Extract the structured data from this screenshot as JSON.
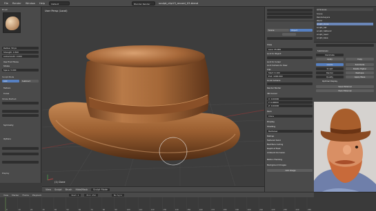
{
  "topbar": {
    "menu": [
      "File",
      "Render",
      "Window",
      "Help"
    ],
    "layout": "Default",
    "engine": "Blender Render",
    "title": "sculpt_clip13_record_03.blend"
  },
  "left_panel": {
    "brush_name": "Brush",
    "rows": [
      "Radius: 50 px",
      "Strength: 0.500",
      "Autosmooth: 0.000",
      "Use Front Faces",
      "Stroke",
      "Space: 5.000",
      "Texture",
      "Curve",
      "Symmetry",
      "Options"
    ],
    "labels": [
      "Sculpt Mode",
      "Stroke Method:",
      "Display"
    ],
    "add_remove": [
      "Add",
      "Subtract"
    ]
  },
  "viewport": {
    "label": "User Persp (Local)",
    "corner": "(1) Clone"
  },
  "vp_header": {
    "items": [
      "View",
      "Sculpt",
      "Brush",
      "Hide/Mask",
      "Sculpt Mode"
    ]
  },
  "properties": {
    "head_view": "View",
    "head_3d_cursor": "3D Cursor",
    "head_item": "Item",
    "head_display": "Display",
    "head_shading": "Shading",
    "rows": [
      "Lens: 35.000",
      "Lock to Object:",
      "Lock to Cursor",
      "Lock Camera to View",
      "Clip:",
      "Start: 0.100",
      "End: 1000.000",
      "Local Camera:",
      "Render Border",
      "X: 0.00000",
      "Y: 0.00000",
      "Z: 0.00000",
      "Clone",
      "Multiview",
      "Matcap",
      "Textured Solid",
      "Backface Culling",
      "Depth of Field",
      "Ambient Occlusion",
      "Motion Tracking",
      "Background Images",
      "Add Image"
    ],
    "tab_labels": [
      "Scene",
      "Object"
    ]
  },
  "outliner": {
    "header": "All Scenes",
    "items": [
      "Scene",
      "RenderLayers",
      "World",
      "sculpt_clone",
      "sculpt_hat",
      "sculpt_hatband",
      "sculpt_head",
      "sculpt_base"
    ]
  },
  "tools": {
    "header": "Brush",
    "rows": [
      "Subdivision",
      "Decimate",
      "Apply",
      "Copy",
      "Levels",
      "Sculpt",
      "Render",
      "Quality",
      "Optimal Display",
      "Subdivide",
      "Delete Higher",
      "Reshape",
      "Apply Base",
      "Save External",
      "Pack External"
    ]
  },
  "timeline": {
    "items": [
      "View",
      "Marker",
      "Frame",
      "Playback",
      "Start: 1",
      "End: 250",
      "No Sync"
    ],
    "ticks": [
      "0",
      "10",
      "20",
      "30",
      "40",
      "50",
      "60",
      "70",
      "80",
      "90",
      "100",
      "110",
      "120",
      "130",
      "140",
      "150",
      "160",
      "170",
      "180",
      "190",
      "200",
      "210",
      "220",
      "230",
      "240",
      "250"
    ]
  },
  "colors": {
    "hat_main": "#a8693a",
    "hat_shadow": "#6b3e1f",
    "hat_highlight": "#d7a171",
    "ui_panel": "#4a4a4a",
    "ui_field": "#2e2e2e",
    "accent_blue": "#5680c2",
    "accent_orange": "#c27a2e"
  },
  "icons": [
    "brush-icon",
    "search-icon",
    "eye-icon",
    "camera-icon",
    "wrench-icon",
    "play-icon"
  ]
}
